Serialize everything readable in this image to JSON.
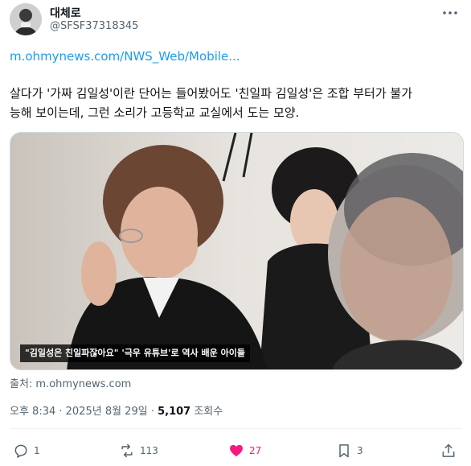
{
  "tweet": {
    "author": {
      "name": "대체로",
      "handle": "@SFSF37318345"
    },
    "link_text": "m.ohmynews.com/NWS_Web/Mobile...",
    "body": "살다가 '가짜 김일성'이란 단어는 들어봤어도 '친일파 김일성'은 조합 부터가 불가\n능해 보이는데, 그런 소리가 고등학교 교실에서 도는 모양.",
    "media": {
      "caption": "\"김일성은 친일파잖아요\" '극우 유튜브'로 역사 배운 아이들"
    },
    "source": "출처: m.ohmynews.com",
    "timestamp": "오후 8:34 · 2025년 8월 29일 · ",
    "views_count": "5,107",
    "views_label": " 조회수",
    "actions": {
      "replies": "1",
      "reposts": "113",
      "likes": "27",
      "bookmarks": "3"
    },
    "colors": {
      "link": "#1d9bf0",
      "like": "#f91880",
      "muted": "#536471",
      "text": "#0f1419"
    }
  }
}
